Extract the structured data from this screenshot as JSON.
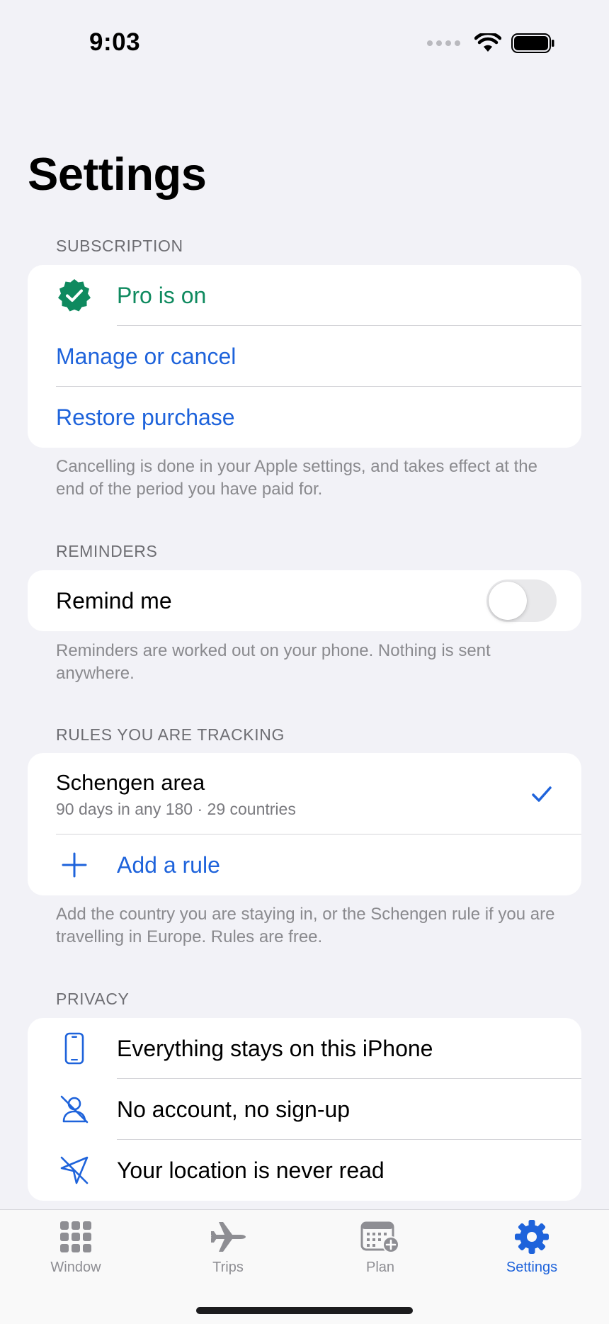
{
  "status_bar": {
    "time": "9:03"
  },
  "title": "Settings",
  "subscription": {
    "header": "SUBSCRIPTION",
    "pro_status": "Pro is on",
    "manage_label": "Manage or cancel",
    "restore_label": "Restore purchase",
    "footnote": "Cancelling is done in your Apple settings, and takes effect at the end of the period you have paid for."
  },
  "reminders": {
    "header": "REMINDERS",
    "remind_label": "Remind me",
    "remind_enabled": false,
    "footnote": "Reminders are worked out on your phone. Nothing is sent anywhere."
  },
  "rules": {
    "header": "RULES YOU ARE TRACKING",
    "items": [
      {
        "title": "Schengen area",
        "subtitle": "90 days in any 180 · 29 countries",
        "selected": true
      }
    ],
    "add_label": "Add a rule",
    "footnote": "Add the country you are staying in, or the Schengen rule if you are travelling in Europe. Rules are free."
  },
  "privacy": {
    "header": "PRIVACY",
    "items": [
      {
        "label": "Everything stays on this iPhone",
        "icon": "iphone-icon"
      },
      {
        "label": "No account, no sign-up",
        "icon": "person-slash-icon"
      },
      {
        "label": "Your location is never read",
        "icon": "location-slash-icon"
      }
    ]
  },
  "tabs": [
    {
      "label": "Window",
      "icon": "grid-icon",
      "active": false
    },
    {
      "label": "Trips",
      "icon": "airplane-icon",
      "active": false
    },
    {
      "label": "Plan",
      "icon": "calendar-plus-icon",
      "active": false
    },
    {
      "label": "Settings",
      "icon": "gear-icon",
      "active": true
    }
  ],
  "colors": {
    "accent": "#1E63DB",
    "success": "#0F8A5F",
    "background": "#F2F2F7"
  }
}
